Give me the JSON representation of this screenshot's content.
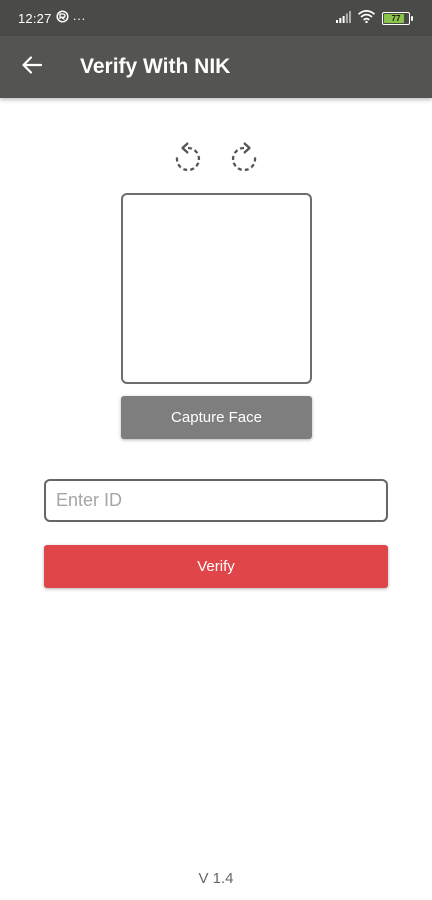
{
  "status_bar": {
    "time": "12:27",
    "more_dots": "···",
    "battery_level": "77",
    "battery_fraction": 0.77,
    "battery_color": "#8bc34a"
  },
  "app_bar": {
    "title": "Verify With NIK",
    "background": "#545551"
  },
  "camera": {
    "rotate_left_icon": "rotate-left-icon",
    "rotate_right_icon": "rotate-right-icon",
    "capture_label": "Capture Face"
  },
  "form": {
    "id_value": "",
    "id_placeholder": "Enter ID",
    "verify_label": "Verify",
    "verify_color": "#e0454a"
  },
  "footer": {
    "version": "V 1.4"
  }
}
